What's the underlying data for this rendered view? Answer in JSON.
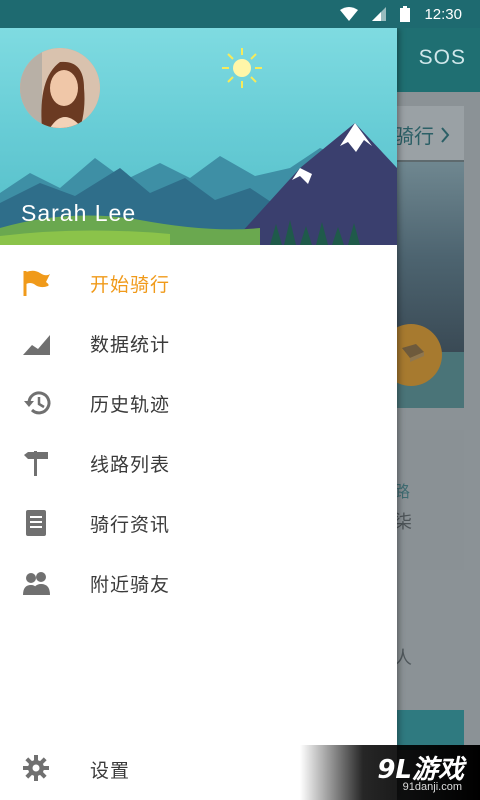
{
  "status_bar": {
    "time": "12:30",
    "icons": [
      "wifi-icon",
      "signal-icon",
      "battery-icon"
    ]
  },
  "background": {
    "appbar_action": "SOS",
    "card1_title": "骑行",
    "card2_line1": "路",
    "card2_line2": "柒",
    "card3_line": "人"
  },
  "drawer": {
    "user_name": "Sarah Lee",
    "menu": [
      {
        "label": "开始骑行",
        "icon": "flag-icon",
        "active": true
      },
      {
        "label": "数据统计",
        "icon": "chart-area-icon",
        "active": false
      },
      {
        "label": "历史轨迹",
        "icon": "history-icon",
        "active": false
      },
      {
        "label": "线路列表",
        "icon": "signpost-icon",
        "active": false
      },
      {
        "label": "骑行资讯",
        "icon": "document-icon",
        "active": false
      },
      {
        "label": "附近骑友",
        "icon": "people-icon",
        "active": false
      }
    ],
    "settings": {
      "label": "设置",
      "icon": "gear-icon"
    }
  },
  "watermark": {
    "logo": "9L游戏",
    "site": "91danji.com"
  },
  "colors": {
    "accent": "#f09a1a",
    "appbar": "#1f6f72",
    "icon_gray": "#707070"
  }
}
